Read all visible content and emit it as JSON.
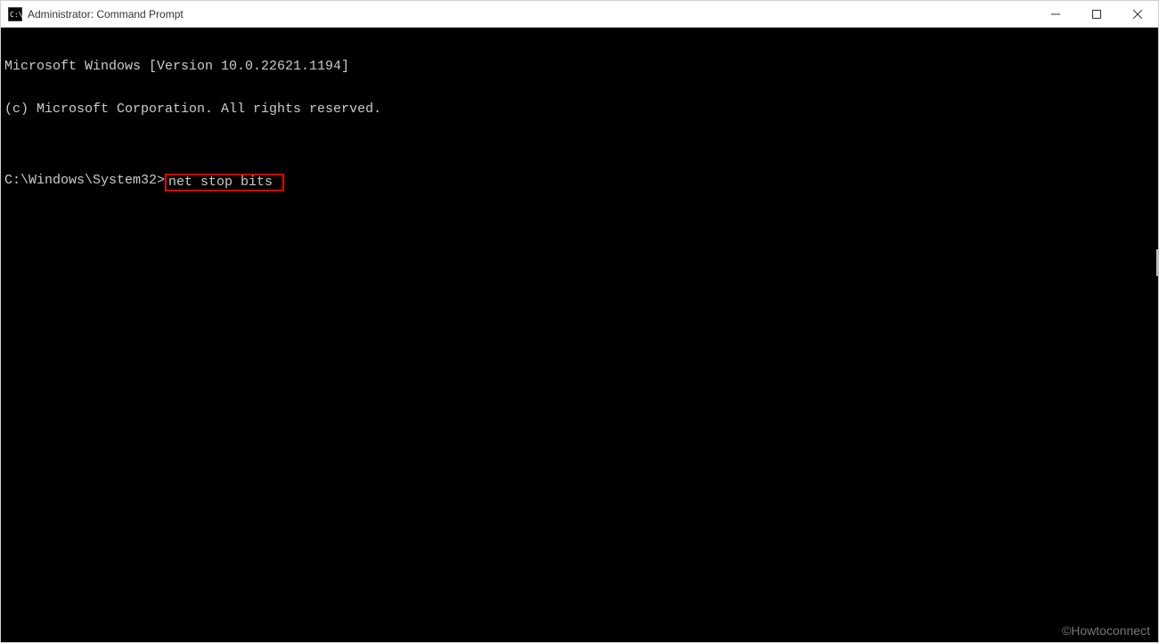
{
  "titlebar": {
    "title": "Administrator: Command Prompt",
    "icon_name": "cmd-icon"
  },
  "window_controls": {
    "minimize": "minimize-icon",
    "maximize": "maximize-icon",
    "close": "close-icon"
  },
  "console": {
    "line1": "Microsoft Windows [Version 10.0.22621.1194]",
    "line2": "(c) Microsoft Corporation. All rights reserved.",
    "blank": "",
    "prompt": "C:\\Windows\\System32>",
    "command": "net stop bits"
  },
  "watermark": "©Howtoconnect"
}
